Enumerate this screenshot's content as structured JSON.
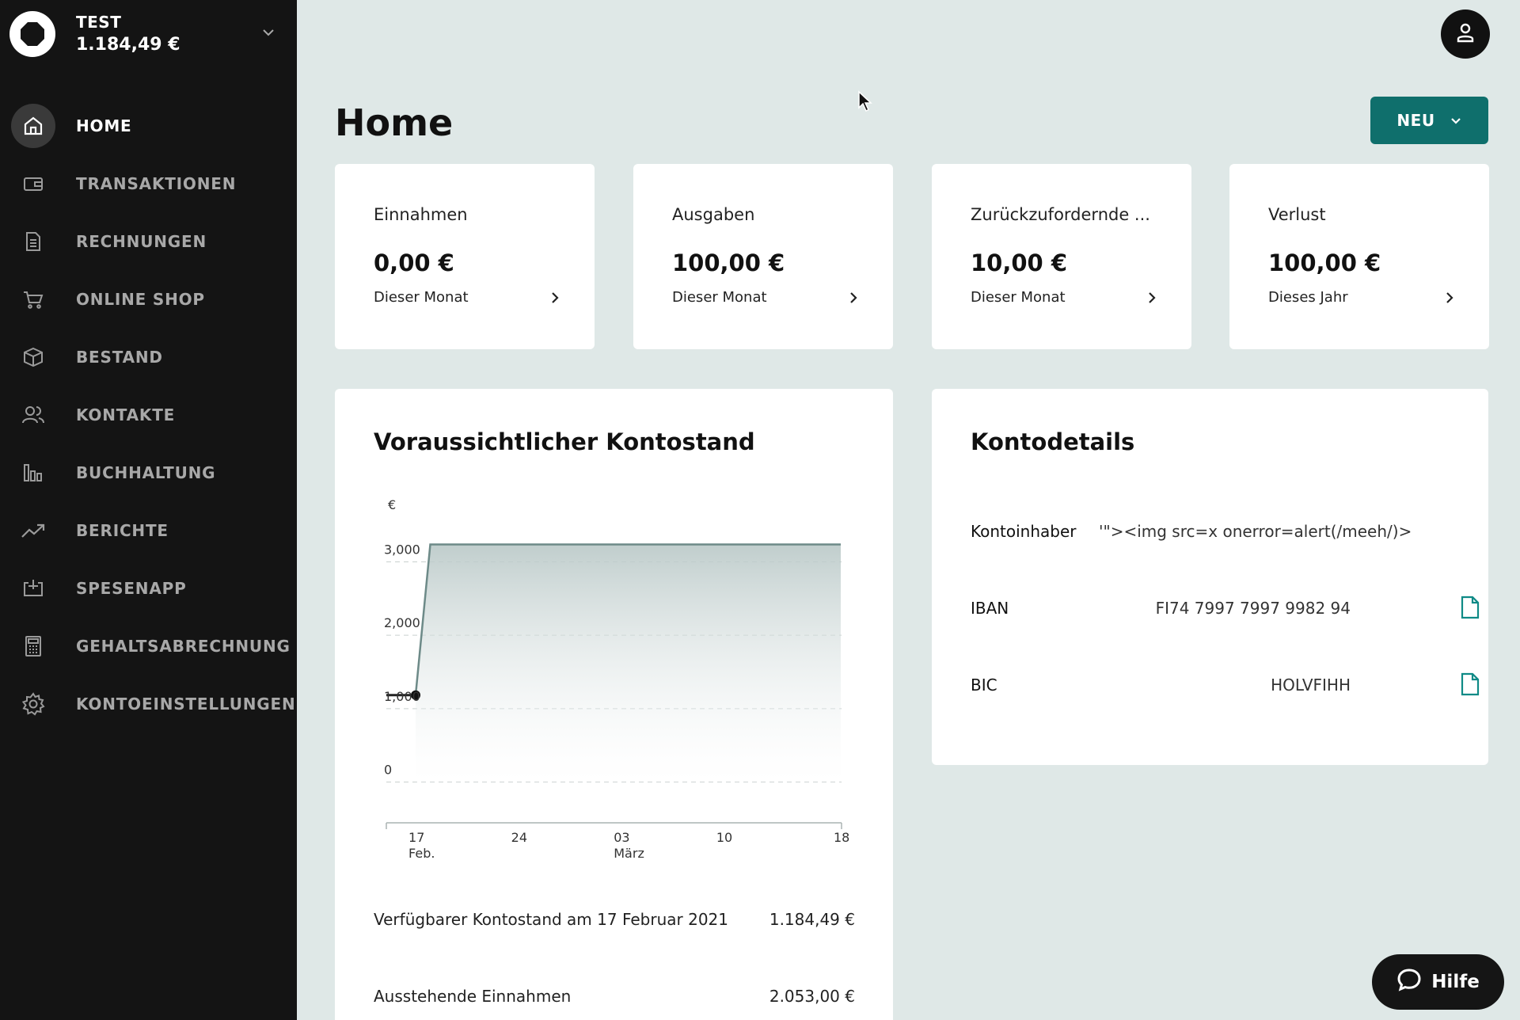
{
  "account": {
    "name": "TEST",
    "balance": "1.184,49 €"
  },
  "nav": [
    {
      "label": "HOME",
      "icon": "home-icon",
      "active": true
    },
    {
      "label": "TRANSAKTIONEN",
      "icon": "wallet-icon"
    },
    {
      "label": "RECHNUNGEN",
      "icon": "document-icon"
    },
    {
      "label": "ONLINE SHOP",
      "icon": "cart-icon"
    },
    {
      "label": "BESTAND",
      "icon": "box-icon"
    },
    {
      "label": "KONTAKTE",
      "icon": "contacts-icon"
    },
    {
      "label": "BUCHHALTUNG",
      "icon": "bar-chart-icon"
    },
    {
      "label": "BERICHTE",
      "icon": "trending-icon"
    },
    {
      "label": "SPESENAPP",
      "icon": "receipt-add-icon"
    },
    {
      "label": "GEHALTSABRECHNUNG",
      "icon": "calculator-icon"
    },
    {
      "label": "KONTOEINSTELLUNGEN",
      "icon": "gear-icon"
    }
  ],
  "page": {
    "title": "Home",
    "new_button": "NEU"
  },
  "stats": [
    {
      "title": "Einnahmen",
      "value": "0,00 €",
      "period": "Dieser Monat"
    },
    {
      "title": "Ausgaben",
      "value": "100,00 €",
      "period": "Dieser Monat"
    },
    {
      "title": "Zurückzufordernde ...",
      "value": "10,00 €",
      "period": "Dieser Monat"
    },
    {
      "title": "Verlust",
      "value": "100,00 €",
      "period": "Dieses Jahr"
    }
  ],
  "forecast": {
    "title": "Voraussichtlicher Kontostand",
    "summary": [
      {
        "label": "Verfügbarer Kontostand am 17 Februar 2021",
        "value": "1.184,49 €"
      },
      {
        "label": "Ausstehende Einnahmen",
        "value": "2.053,00 €"
      }
    ]
  },
  "chart_data": {
    "type": "line",
    "title": "Voraussichtlicher Kontostand",
    "ylabel": "€",
    "ylim": [
      -200,
      3200
    ],
    "yticks": [
      0,
      1000,
      2000,
      3000
    ],
    "ytick_labels": [
      "0",
      "1,000",
      "2,000",
      "3,000"
    ],
    "xticks": [
      {
        "day": 17,
        "label": "17",
        "sublabel": "Feb."
      },
      {
        "day": 24,
        "label": "24",
        "sublabel": ""
      },
      {
        "day": 31,
        "label": "03",
        "sublabel": "März"
      },
      {
        "day": 38,
        "label": "10",
        "sublabel": ""
      },
      {
        "day": 46,
        "label": "18",
        "sublabel": ""
      }
    ],
    "series": [
      {
        "x": [
          15,
          17,
          18,
          46
        ],
        "y": [
          1184.49,
          1184.49,
          3237.49,
          3237.49
        ]
      }
    ],
    "marker": {
      "x": 17,
      "y": 1184.49
    },
    "grid": "horizontal-dashed"
  },
  "kontodetails": {
    "title": "Kontodetails",
    "rows": [
      {
        "label": "Kontoinhaber",
        "value": "'\"><img src=x onerror=alert(/meeh/)>"
      },
      {
        "label": "IBAN",
        "value": "FI74 7997 7997 9982 94"
      },
      {
        "label": "BIC",
        "value": "HOLVFIHH"
      }
    ]
  },
  "help": {
    "label": "Hilfe"
  }
}
